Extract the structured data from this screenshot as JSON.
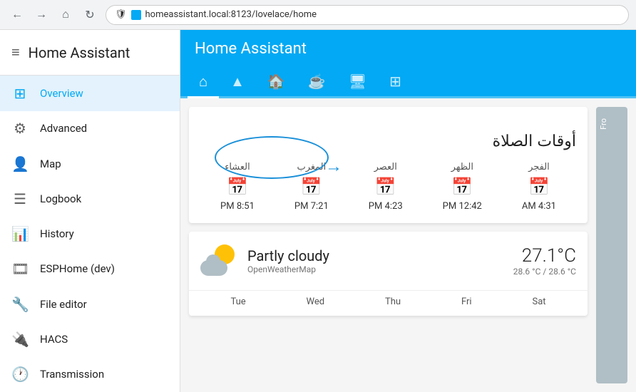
{
  "browser": {
    "back_icon": "←",
    "forward_icon": "→",
    "home_icon": "⌂",
    "refresh_icon": "↻",
    "url": "homeassistant.local:8123/lovelace/home",
    "lock_icon": "🔒",
    "shield_icon": "🛡"
  },
  "sidebar": {
    "title": "Home Assistant",
    "menu_icon": "≡",
    "items": [
      {
        "id": "overview",
        "label": "Overview",
        "icon": "⊞",
        "active": true
      },
      {
        "id": "advanced",
        "label": "Advanced",
        "icon": "⚙"
      },
      {
        "id": "map",
        "label": "Map",
        "icon": "👤"
      },
      {
        "id": "logbook",
        "label": "Logbook",
        "icon": "☰"
      },
      {
        "id": "history",
        "label": "History",
        "icon": "📊"
      },
      {
        "id": "esphome",
        "label": "ESPHome (dev)",
        "icon": "🎞"
      },
      {
        "id": "file-editor",
        "label": "File editor",
        "icon": "🔧"
      },
      {
        "id": "hacs",
        "label": "HACS",
        "icon": "🔌"
      },
      {
        "id": "transmission",
        "label": "Transmission",
        "icon": "🕐"
      }
    ]
  },
  "main": {
    "header_title": "Home Assistant",
    "tabs": [
      {
        "id": "home",
        "icon": "⌂",
        "active": true
      },
      {
        "id": "people",
        "icon": "▲"
      },
      {
        "id": "house",
        "icon": "🏠"
      },
      {
        "id": "cup",
        "icon": "☕"
      },
      {
        "id": "display",
        "icon": "🖥"
      },
      {
        "id": "network",
        "icon": "⊞"
      }
    ]
  },
  "prayer_card": {
    "title": "أوقات الصلاة",
    "annotation_label": "أو قات الصلاة",
    "times": [
      {
        "name": "الفجر",
        "value": "4:31 AM"
      },
      {
        "name": "الظهر",
        "value": "12:42 PM"
      },
      {
        "name": "العصر",
        "value": "4:23 PM"
      },
      {
        "name": "المغرب",
        "value": "7:21 PM"
      },
      {
        "name": "العشاء",
        "value": "8:51 PM"
      }
    ],
    "calendar_icon": "📅"
  },
  "weather_card": {
    "description": "Partly cloudy",
    "source": "OpenWeatherMap",
    "temperature": "27.1°C",
    "range": "28.6 °C / 28.6 °C",
    "days": [
      "Tue",
      "Wed",
      "Thu",
      "Fri",
      "Sat"
    ]
  },
  "side_panel": {
    "label": "Fro"
  }
}
